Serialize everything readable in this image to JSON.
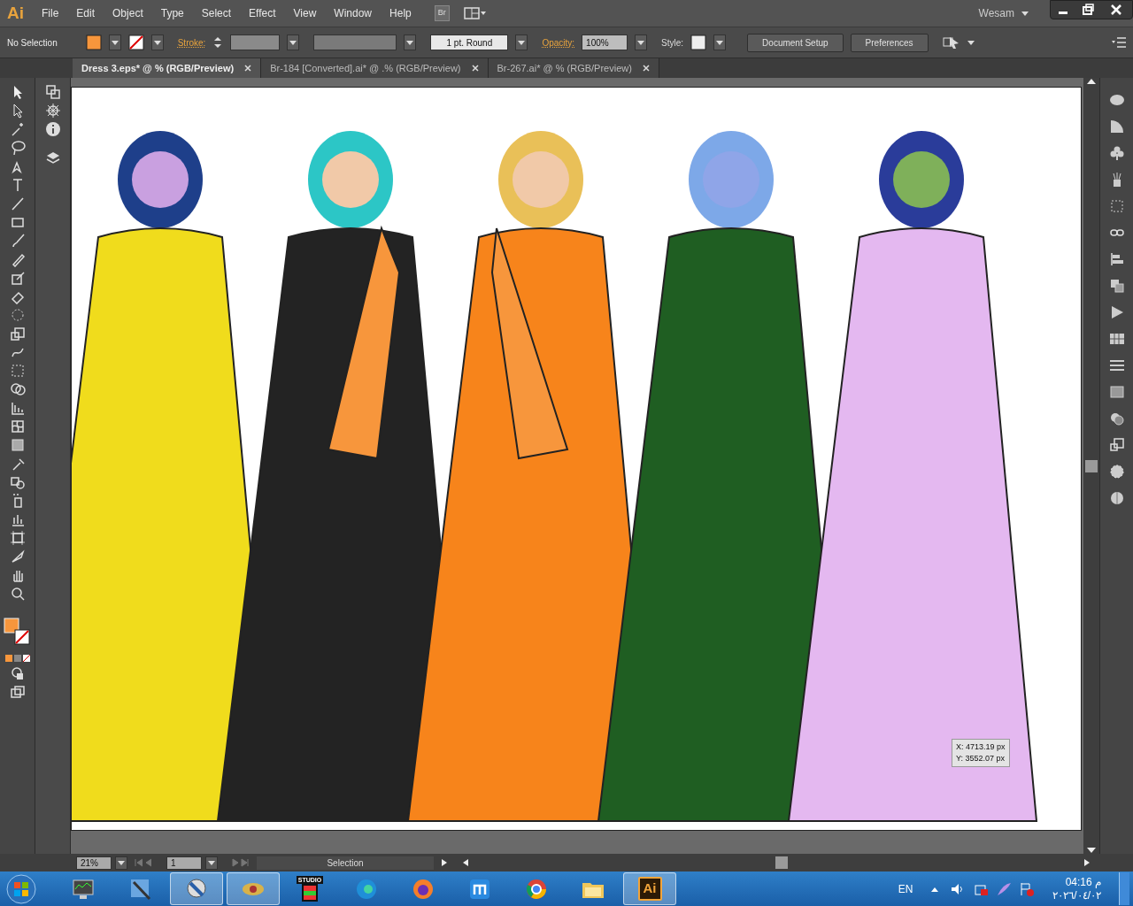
{
  "app": {
    "logo": "Ai",
    "menu": [
      "File",
      "Edit",
      "Object",
      "Type",
      "Select",
      "Effect",
      "View",
      "Window",
      "Help"
    ],
    "bridge": "Br",
    "workspace": "Wesam"
  },
  "control_bar": {
    "selection": "No Selection",
    "stroke_label": "Stroke:",
    "brush": "1 pt. Round",
    "opacity_label": "Opacity:",
    "opacity": "100%",
    "style_label": "Style:",
    "buttons": [
      "Document Setup",
      "Preferences"
    ]
  },
  "tabs": [
    {
      "label": "Dress 3.eps* @ % (RGB/Preview)",
      "selected": true
    },
    {
      "label": "Br-184 [Converted].ai* @ .% (RGB/Preview)",
      "selected": false
    },
    {
      "label": "Br-267.ai* @ % (RGB/Preview)",
      "selected": false
    }
  ],
  "canvas": {
    "readout": [
      "X: 4713.19 px",
      "Y: 3552.07 px"
    ]
  },
  "status_bar": {
    "zoom": "21%",
    "artboard": "1",
    "tool": "Selection"
  },
  "taskbar": {
    "apps": [
      {
        "kind": "monitor",
        "highlighted": false
      },
      {
        "kind": "pen",
        "highlighted": false
      },
      {
        "kind": "media",
        "highlighted": true
      },
      {
        "kind": "eye",
        "highlighted": true
      },
      {
        "kind": "studio",
        "label": "STUDIO",
        "highlighted": false
      },
      {
        "kind": "edge",
        "highlighted": false
      },
      {
        "kind": "firefox",
        "highlighted": false
      },
      {
        "kind": "maxthon",
        "highlighted": false
      },
      {
        "kind": "chrome",
        "highlighted": false
      },
      {
        "kind": "folder",
        "highlighted": false
      },
      {
        "kind": "illustrator",
        "label": "Ai",
        "highlighted": true
      }
    ],
    "language": "EN",
    "time": "04:16 م",
    "date": "٢٠٢٦/٠٤/٠٢"
  }
}
